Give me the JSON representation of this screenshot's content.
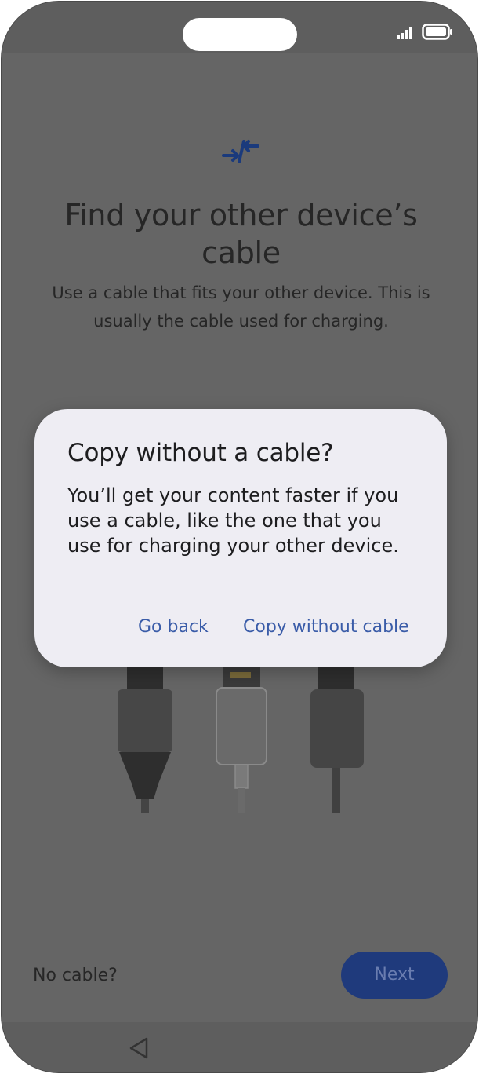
{
  "status_bar": {
    "signal_icon": "signal-bars-icon",
    "battery_icon": "battery-icon"
  },
  "header": {
    "icon": "transfer-arrows-icon",
    "icon_color": "#1a3a7c"
  },
  "page": {
    "title": "Find your other device’s cable",
    "subtitle": "Use a cable that fits your other device. This is usually the cable used for charging."
  },
  "illustration": {
    "items": [
      "usb-a-cable",
      "lightning-cable",
      "usb-c-cable"
    ]
  },
  "footer": {
    "no_cable_label": "No cable?",
    "next_label": "Next",
    "accent_color": "#1f3a7c"
  },
  "navigation": {
    "back_icon": "back-triangle-icon"
  },
  "dialog": {
    "title": "Copy without a cable?",
    "body": "You’ll get your content faster if you use a cable, like the one that you use for charging your other device.",
    "go_back_label": "Go back",
    "copy_without_label": "Copy without cable",
    "button_color": "#3a5ca8"
  }
}
